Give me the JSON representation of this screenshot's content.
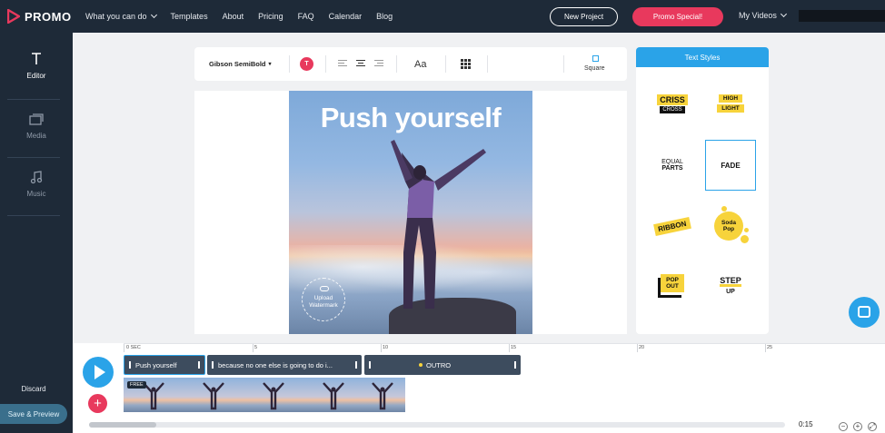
{
  "brand": {
    "name": "PROMO",
    "accent": "#e8395d",
    "primary": "#2aa3e8",
    "nav_bg": "#1e2a38"
  },
  "nav": {
    "links": [
      {
        "label": "What you can do",
        "dropdown": true
      },
      {
        "label": "Templates"
      },
      {
        "label": "About"
      },
      {
        "label": "Pricing"
      },
      {
        "label": "FAQ"
      },
      {
        "label": "Calendar"
      },
      {
        "label": "Blog"
      }
    ],
    "new_project": "New Project",
    "promo_special": "Promo Special!",
    "my_videos": "My Videos"
  },
  "sidebar": {
    "items": [
      {
        "label": "Editor",
        "icon": "text-icon",
        "active": true
      },
      {
        "label": "Media",
        "icon": "media-icon",
        "active": false
      },
      {
        "label": "Music",
        "icon": "music-icon",
        "active": false
      }
    ],
    "discard": "Discard",
    "save_preview": "Save & Preview"
  },
  "toolbar": {
    "font": "Gibson SemiBold",
    "color_letter": "T",
    "aa": "Aa",
    "ratio": "Square"
  },
  "canvas": {
    "title": "Push yourself",
    "watermark": "Upload Watermark"
  },
  "text_styles": {
    "header": "Text Styles",
    "criss": [
      "CRISS",
      "CROSS"
    ],
    "highlight": [
      "HIGH",
      "LIGHT"
    ],
    "equal": [
      "EQUAL",
      "PARTS"
    ],
    "fade": "FADE",
    "ribbon": "RIBBON",
    "soda": [
      "Soda",
      "Pop"
    ],
    "popout": [
      "POP",
      "OUT"
    ],
    "step": [
      "STEP",
      "UP"
    ],
    "selected": "FADE"
  },
  "timeline": {
    "ticks": [
      "0 SEC",
      "5",
      "10",
      "15",
      "20",
      "25"
    ],
    "clips": [
      {
        "label": "Push yourself",
        "selected": true
      },
      {
        "label": "because no one else is going to do i...",
        "selected": false
      },
      {
        "label": "OUTRO",
        "selected": false
      }
    ],
    "free_badge": "FREE",
    "duration": "0:15",
    "zoom_out": "−",
    "zoom_in": "+"
  }
}
